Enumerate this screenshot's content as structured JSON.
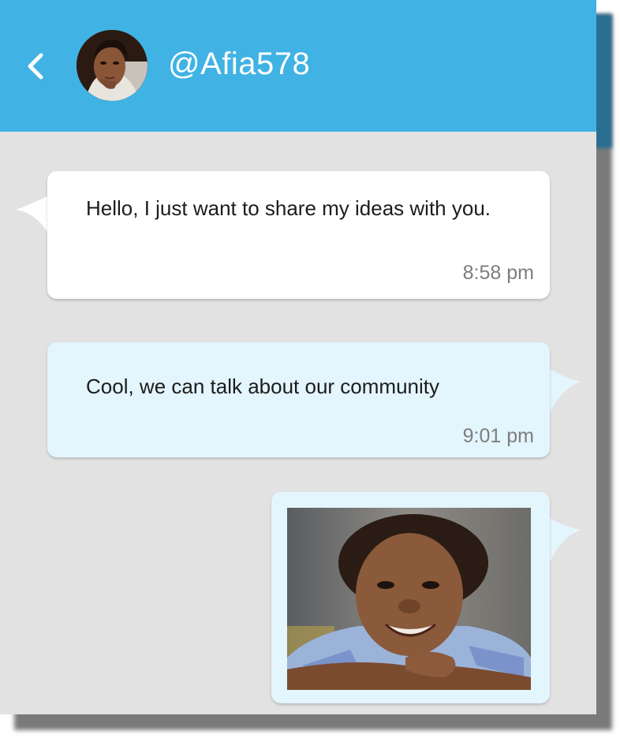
{
  "header": {
    "back_icon": "chevron-left-icon",
    "username": "@Afia578",
    "colors": {
      "background": "#40b2e4",
      "text": "#ffffff"
    }
  },
  "messages": [
    {
      "direction": "incoming",
      "text": "Hello, I just want to share my ideas with you.",
      "time": "8:58 pm"
    },
    {
      "direction": "outgoing",
      "text": "Cool, we can talk about our community",
      "time": "9:01 pm"
    },
    {
      "direction": "outgoing",
      "type": "image",
      "image_description": "photo of a smiling child"
    }
  ],
  "colors": {
    "chat_background": "#e2e2e2",
    "incoming_bubble": "#ffffff",
    "outgoing_bubble": "#e3f5fd",
    "timestamp": "#7d7d7d"
  }
}
